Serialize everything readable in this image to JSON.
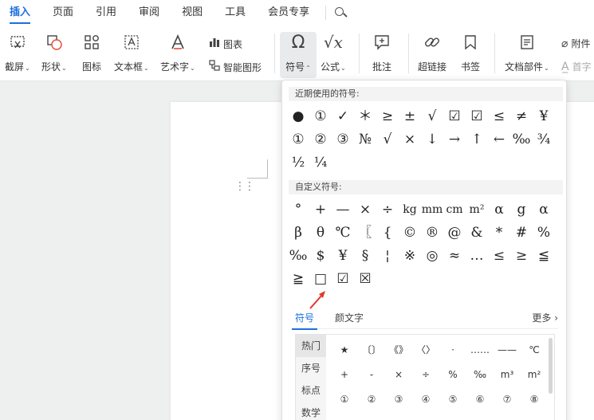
{
  "menubar": {
    "tabs": [
      "插入",
      "页面",
      "引用",
      "审阅",
      "视图",
      "工具",
      "会员专享"
    ],
    "active": "插入"
  },
  "ribbon": {
    "screenshot": "截屏",
    "shape": "形状",
    "icon": "图标",
    "textbox": "文本框",
    "wordart": "艺术字",
    "chart": "图表",
    "smartart": "智能图形",
    "symbol": "符号",
    "formula": "公式",
    "comment": "批注",
    "hyperlink": "超链接",
    "bookmark": "书签",
    "docpart": "文档部件",
    "attachment": "附件",
    "dropcap": "首字"
  },
  "panel": {
    "recent_title": "近期使用的符号:",
    "recent": [
      "●",
      "①",
      "✓",
      "＊",
      "≥",
      "±",
      "√",
      "☑",
      "☑",
      "≤",
      "≠",
      "¥",
      "①",
      "②",
      "③",
      "№",
      "√",
      "×",
      "↓",
      "→",
      "↑",
      "←",
      "‰",
      "¾",
      "½",
      "¼"
    ],
    "custom_title": "自定义符号:",
    "custom": [
      "°",
      "+",
      "—",
      "×",
      "÷",
      "kg",
      "mm",
      "cm",
      "m²",
      "α",
      "g",
      "α",
      "β",
      "θ",
      "℃",
      "〖",
      "{",
      "©",
      "®",
      "@",
      "&",
      "*",
      "#",
      "%",
      "‰",
      "$",
      "¥",
      "§",
      "¦",
      "※",
      "◎",
      "≈",
      "…",
      "≤",
      "≥",
      "≦",
      "≧",
      "□",
      "☑",
      "☒"
    ],
    "tabs": [
      "符号",
      "颜文字"
    ],
    "active_tab": "符号",
    "more": "更多 ›",
    "categories": [
      "热门",
      "序号",
      "标点",
      "数学"
    ],
    "active_category": "热门",
    "browser_symbols": [
      "★",
      "〔〕",
      "《》",
      "〈〉",
      "·",
      "……",
      "——",
      "℃",
      "+",
      "-",
      "×",
      "÷",
      "%",
      "‰",
      "m³",
      "m²",
      "①",
      "②",
      "③",
      "④",
      "⑤",
      "⑥",
      "⑦",
      "⑧"
    ]
  },
  "colors": {
    "accent": "#1f6fdb",
    "arrow": "#e0392b"
  }
}
